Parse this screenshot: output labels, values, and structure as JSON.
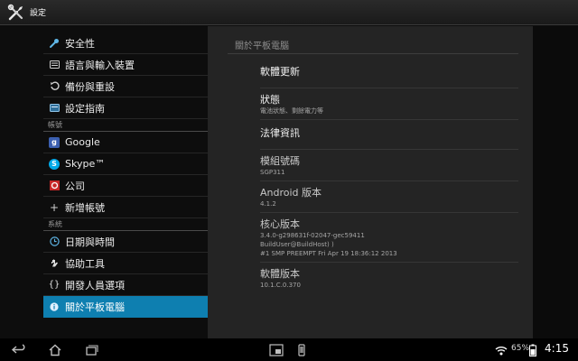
{
  "app": {
    "title": "設定",
    "icon": "settings-tools-icon"
  },
  "sidebar": {
    "groups": [
      {
        "items": [
          {
            "label": "安全性",
            "icon": "wrench-icon"
          },
          {
            "label": "語言與輸入裝置",
            "icon": "keyboard-icon"
          },
          {
            "label": "備份與重設",
            "icon": "restore-icon"
          },
          {
            "label": "設定指南",
            "icon": "guide-icon"
          }
        ]
      },
      {
        "header": "帳號",
        "items": [
          {
            "label": "Google",
            "icon": "google-icon"
          },
          {
            "label": "Skype™",
            "icon": "skype-icon"
          },
          {
            "label": "公司",
            "icon": "company-icon"
          },
          {
            "label": "新增帳號",
            "icon": "plus-icon"
          }
        ]
      },
      {
        "header": "系統",
        "items": [
          {
            "label": "日期與時間",
            "icon": "clock-icon"
          },
          {
            "label": "協助工具",
            "icon": "hand-icon"
          },
          {
            "label": "開發人員選項",
            "icon": "braces-icon"
          },
          {
            "label": "關於平板電腦",
            "icon": "info-icon",
            "selected": true
          }
        ]
      }
    ]
  },
  "main": {
    "title": "關於平板電腦",
    "prefs": [
      {
        "title": "軟體更新"
      },
      {
        "title": "狀態",
        "summary": "電池狀態、剩餘電力等"
      },
      {
        "title": "法律資訊"
      },
      {
        "title": "模組號碼",
        "summary": "SGP311"
      },
      {
        "title": "Android 版本",
        "summary": "4.1.2"
      },
      {
        "title": "核心版本",
        "summary_lines": [
          "3.4.0-g298631f-02047-gec59411",
          "BuildUser@BuildHost) )",
          "#1 SMP PREEMPT Fri Apr 19 18:36:12 2013"
        ]
      },
      {
        "title": "軟體版本",
        "summary": "10.1.C.0.370"
      }
    ]
  },
  "navbar": {
    "battery": "65%",
    "time": "4:15",
    "icons": [
      "back-icon",
      "home-icon",
      "recent-apps-icon",
      "small-app-icon",
      "phone-icon",
      "wifi-icon",
      "battery-icon"
    ]
  },
  "colors": {
    "accent": "#0e7fb0",
    "pane": "#242424",
    "background": "#0d0d0d"
  }
}
